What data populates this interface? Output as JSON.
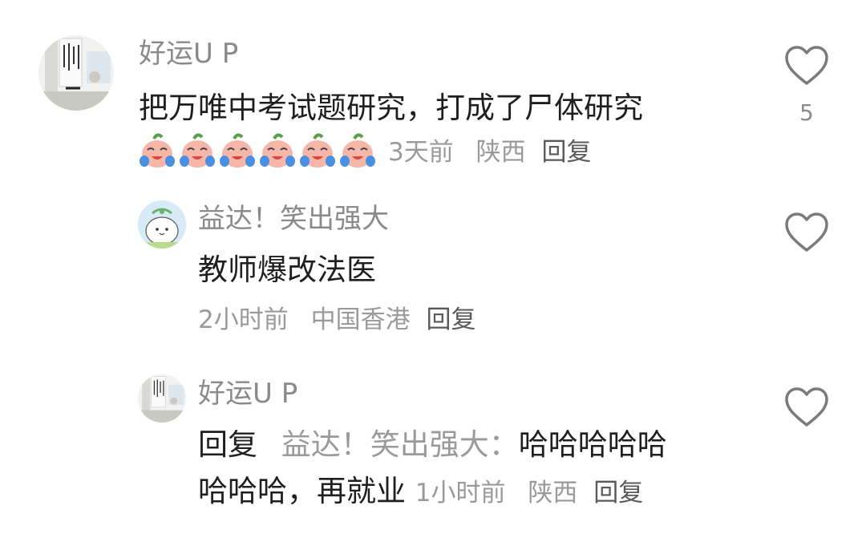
{
  "comments": [
    {
      "username": "好运U P",
      "text": "把万唯中考试题研究，打成了尸体研究",
      "emoji_icon": "crying-laughing-peach-sticker",
      "emoji_count": 6,
      "time": "3天前",
      "location": "陕西",
      "reply_label": "回复",
      "likes": "5"
    },
    {
      "username": "益达！笑出强大",
      "text": "教师爆改法医",
      "time": "2小时前",
      "location": "中国香港",
      "reply_label": "回复"
    },
    {
      "username": "好运U P",
      "reply_prefix": "回复",
      "reply_to": "益达！笑出强大：",
      "text_line1": "哈哈哈哈哈",
      "text_line2": "哈哈哈，再就业",
      "time": "1小时前",
      "location": "陕西",
      "reply_label": "回复"
    }
  ],
  "colors": {
    "text": "#1f1f1f",
    "secondary": "#8a8a8a",
    "reply_action": "#5a5a5a"
  },
  "icons": {
    "like": "heart-outline-icon"
  }
}
